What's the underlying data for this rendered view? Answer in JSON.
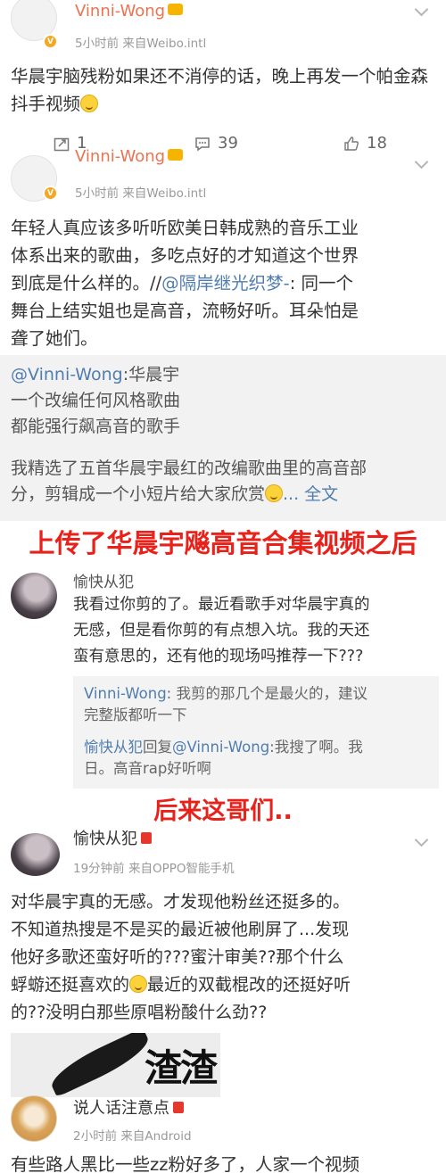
{
  "post1": {
    "username": "Vinni-Wong",
    "meta": "5小时前  来自Weibo.intl",
    "text": "华晨宇脑残粉如果还不消停的话，晚上再发一个帕金森抖手视频",
    "repost_count": "1",
    "comment_count": "39",
    "like_count": "18"
  },
  "post2": {
    "username": "Vinni-Wong",
    "meta": "5小时前  来自Weibo.intl",
    "text_lines": [
      "年轻人真应该多听听欧美日韩成熟的音乐工业",
      "体系出来的歌曲，多吃点好的才知道这个世界",
      "到底是什么样的。//",
      "@隔岸继光织梦-",
      ": 同一个",
      "舞台上结实姐也是高音，流畅好听。耳朵怕是",
      "聋了她们。"
    ],
    "repost": {
      "mention": "@Vinni-Wong",
      "line1": ":华晨宇",
      "line2": "一个改编任何风格歌曲",
      "line3": "都能强行飙高音的歌手",
      "line4": "我精选了五首华晨宇最红的改编歌曲里的高音部",
      "line5": "分，剪辑成一个小短片给大家欣赏",
      "more": "... 全文"
    }
  },
  "banner1": "上传了华晨宇飚高音合集视频之后",
  "comment1": {
    "username": "愉快从犯",
    "text_lines": [
      "我看过你剪的了。最近看歌手对华晨宇真的",
      "无感，但是看你剪的有点想入坑。我的天还",
      "蛮有意思的，还有他的现场吗推荐一下???"
    ],
    "reply1_user": "Vinni-Wong",
    "reply1_text": ": 我剪的那几个是最火的，建议",
    "reply1_text2": "完整版都听一下",
    "reply2_user": "愉快从犯",
    "reply2_mid": "回复",
    "reply2_mention": "@Vinni-Wong",
    "reply2_text": ":我搜了啊。我",
    "reply2_text2": "日。高音rap好听啊"
  },
  "banner2": "后来这哥们..",
  "post3": {
    "username": "愉快从犯",
    "meta": "19分钟前  来自OPPO智能手机",
    "text_lines": [
      "对华晨宇真的无感。才发现他粉丝还挺多的。",
      "不知道热搜是不是买的最近被他刷屏了...发现",
      "他好多歌还蛮好听的???蜜汁审美??那个什么",
      "蜉蝣还挺喜欢的",
      "最近的双截棍改的还挺好听",
      "的??没明白那些原唱粉酸什么劲??"
    ],
    "image_text": "渣渣"
  },
  "post4": {
    "username": "说人话注意点",
    "meta": "2小时前  来自Android",
    "text": "有些路人黑比一些zz粉好多了，人家一个视频"
  },
  "colors": {
    "username_orange": "#eb7350",
    "link_blue": "#507daf",
    "banner_red": "#e8211a",
    "vip_gold": "#f5a623"
  },
  "icons": [
    "chevron-down-icon",
    "repost-icon",
    "comment-icon",
    "like-icon",
    "verified-icon",
    "crown-icon",
    "red-packet-icon",
    "smile-emoji-icon"
  ]
}
